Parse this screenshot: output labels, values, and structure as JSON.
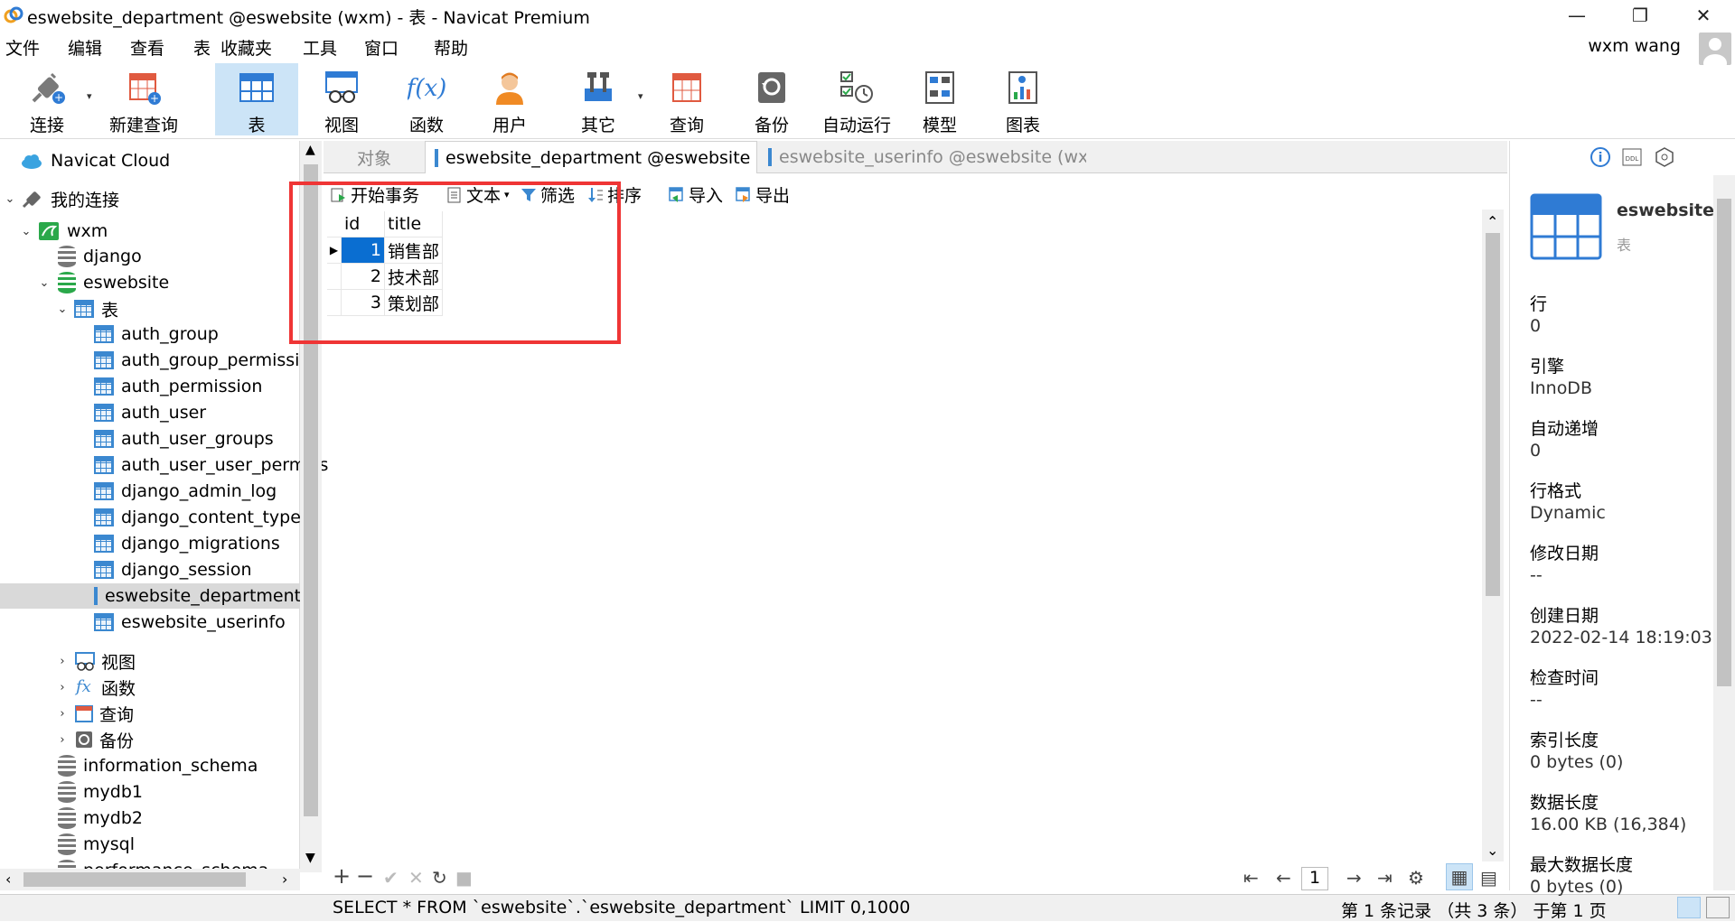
{
  "window": {
    "title": "eswebsite_department @eswebsite (wxm) - 表 - Navicat Premium"
  },
  "menu": [
    "文件",
    "编辑",
    "查看",
    "表",
    "收藏夹",
    "工具",
    "窗口",
    "帮助"
  ],
  "user": {
    "name": "wxm wang"
  },
  "toolbar": [
    {
      "label": "连接",
      "icon": "plug-icon"
    },
    {
      "label": "新建查询",
      "icon": "new-query-icon"
    },
    {
      "label": "表",
      "icon": "table-icon",
      "active": true
    },
    {
      "label": "视图",
      "icon": "view-icon"
    },
    {
      "label": "函数",
      "icon": "function-icon"
    },
    {
      "label": "用户",
      "icon": "user-icon"
    },
    {
      "label": "其它",
      "icon": "tools-icon"
    },
    {
      "label": "查询",
      "icon": "query-icon"
    },
    {
      "label": "备份",
      "icon": "backup-icon"
    },
    {
      "label": "自动运行",
      "icon": "autorun-icon"
    },
    {
      "label": "模型",
      "icon": "model-icon"
    },
    {
      "label": "图表",
      "icon": "chart-icon"
    }
  ],
  "sidebar": {
    "cloud": "Navicat Cloud",
    "my_connections": "我的连接",
    "connection": "wxm",
    "databases_top": [
      "django",
      "eswebsite"
    ],
    "tables_group": "表",
    "tables": [
      "auth_group",
      "auth_group_permission",
      "auth_permission",
      "auth_user",
      "auth_user_groups",
      "auth_user_user_permiss",
      "django_admin_log",
      "django_content_type",
      "django_migrations",
      "django_session",
      "eswebsite_department",
      "eswebsite_userinfo"
    ],
    "selected_table": "eswebsite_department",
    "groups": [
      "视图",
      "函数",
      "查询",
      "备份"
    ],
    "databases_bottom": [
      "information_schema",
      "mydb1",
      "mydb2",
      "mysql",
      "performance_schema"
    ]
  },
  "tabs": [
    "对象",
    "eswebsite_department @eswebsite ...",
    "eswebsite_userinfo @eswebsite (wx..."
  ],
  "grid_toolbar": {
    "begin_tx": "开始事务",
    "text": "文本",
    "filter": "筛选",
    "sort": "排序",
    "import": "导入",
    "export": "导出"
  },
  "grid": {
    "columns": [
      "id",
      "title"
    ],
    "rows": [
      [
        "1",
        "销售部"
      ],
      [
        "2",
        "技术部"
      ],
      [
        "3",
        "策划部"
      ]
    ]
  },
  "pager": {
    "page": "1"
  },
  "status": {
    "sql": "SELECT * FROM `eswebsite`.`eswebsite_department` LIMIT 0,1000",
    "records": "第 1 条记录 （共 3 条） 于第 1 页"
  },
  "info": {
    "name": "eswebsite",
    "type": "表",
    "fields": [
      {
        "label": "行",
        "value": "0"
      },
      {
        "label": "引擎",
        "value": "InnoDB"
      },
      {
        "label": "自动递增",
        "value": "0"
      },
      {
        "label": "行格式",
        "value": "Dynamic"
      },
      {
        "label": "修改日期",
        "value": "--"
      },
      {
        "label": "创建日期",
        "value": "2022-02-14 18:19:03"
      },
      {
        "label": "检查时间",
        "value": "--"
      },
      {
        "label": "索引长度",
        "value": "0 bytes (0)"
      },
      {
        "label": "数据长度",
        "value": "16.00 KB (16,384)"
      },
      {
        "label": "最大数据长度",
        "value": "0 bytes (0)"
      }
    ]
  }
}
